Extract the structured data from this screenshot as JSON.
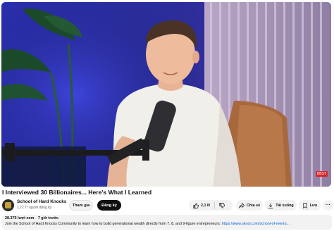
{
  "video": {
    "title": "I Interviewed 30 Billionaires... Here's What I Learned",
    "watermark": "BBST"
  },
  "channel": {
    "name": "School of Hard Knocks",
    "subscribers": "1,72 Tr người đăng ký",
    "join_label": "Tham gia",
    "subscribe_label": "Đăng ký"
  },
  "actions": {
    "like_count": "2,1 N",
    "share_label": "Chia sẻ",
    "download_label": "Tải xuống",
    "save_label": "Lưu",
    "more_label": "···",
    "icons": [
      "thumbs-up-icon",
      "thumbs-down-icon",
      "share-icon",
      "download-icon",
      "save-icon"
    ]
  },
  "description": {
    "views": "28.375 lượt xem",
    "time": "7 giờ trước",
    "text": "Join the School of Hard Knocks Community to learn how to build generational wealth directly from 7, 8, and 9-figure entrepreneurs: ",
    "link": "https://www.skool.com/school-of-mento..."
  },
  "colors": {
    "subscribe_bg": "#0f0f0f",
    "pill_bg": "#f2f2f2",
    "link": "#065fd4"
  }
}
